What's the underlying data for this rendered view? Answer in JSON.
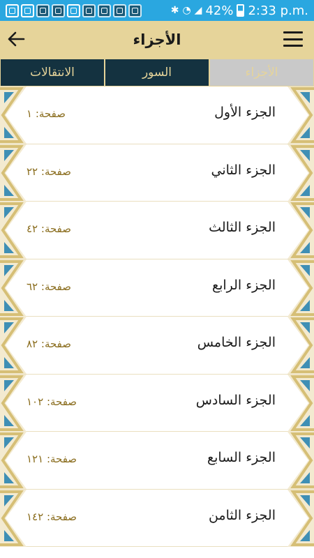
{
  "status_bar": {
    "battery": "42%",
    "time": "2:33 p.m."
  },
  "app_bar": {
    "title": "الأجزاء"
  },
  "tabs": [
    {
      "label": "الانتقالات"
    },
    {
      "label": "السور"
    },
    {
      "label": "الأجزاء"
    }
  ],
  "parts": [
    {
      "name": "الجزء الأول",
      "page": "صفحة: ١"
    },
    {
      "name": "الجزء الثاني",
      "page": "صفحة: ٢٢"
    },
    {
      "name": "الجزء الثالث",
      "page": "صفحة: ٤٢"
    },
    {
      "name": "الجزء الرابع",
      "page": "صفحة: ٦٢"
    },
    {
      "name": "الجزء الخامس",
      "page": "صفحة: ٨٢"
    },
    {
      "name": "الجزء السادس",
      "page": "صفحة: ١٠٢"
    },
    {
      "name": "الجزء السابع",
      "page": "صفحة: ١٢١"
    },
    {
      "name": "الجزء الثامن",
      "page": "صفحة: ١٤٢"
    }
  ],
  "colors": {
    "accent_gold": "#e6d49a",
    "dark_navy": "#143240",
    "status_blue": "#2aa7e0",
    "page_text": "#8a6d1e"
  }
}
